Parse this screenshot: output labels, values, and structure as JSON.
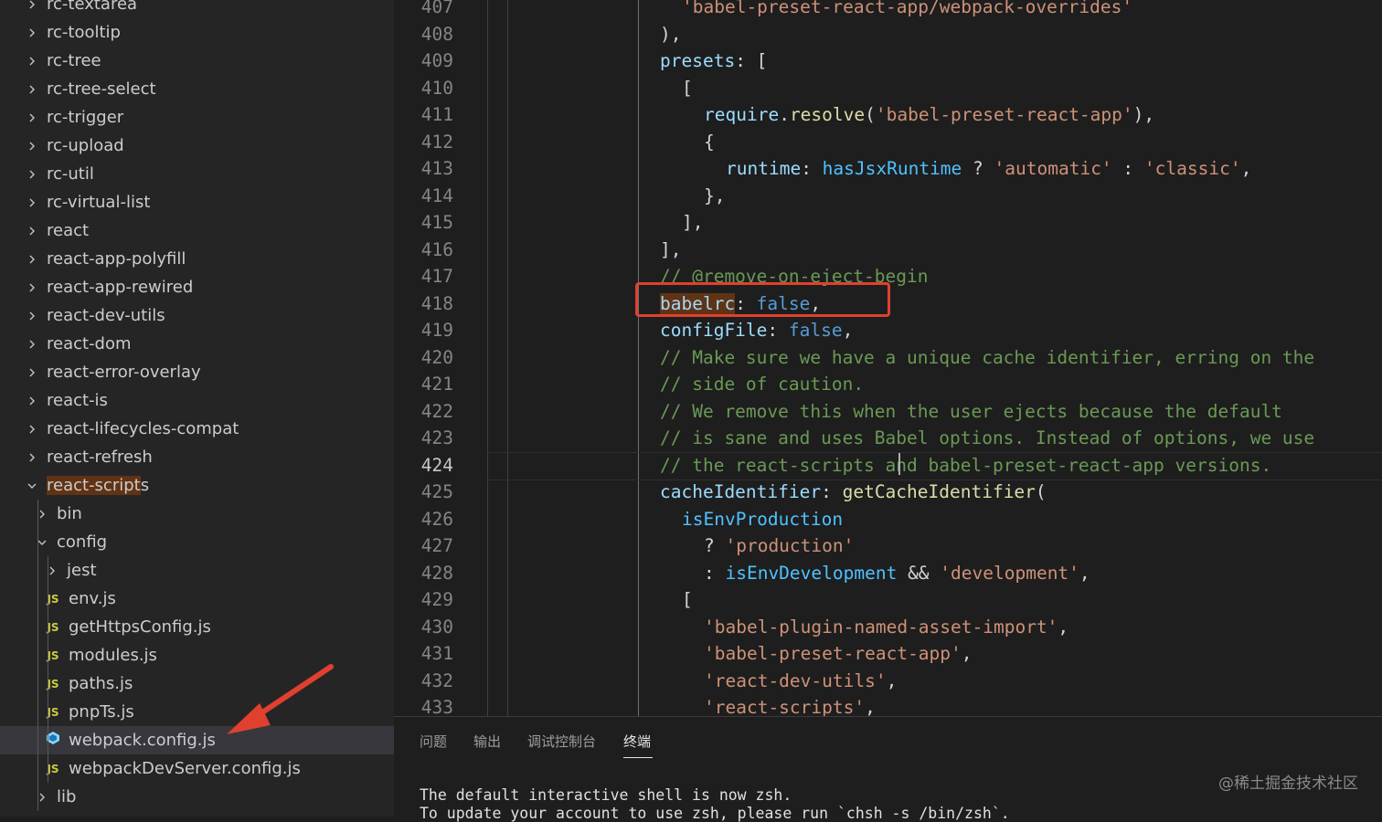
{
  "explorer": {
    "items": [
      {
        "label": "rc-textarea",
        "type": "folder",
        "state": "collapsed",
        "depth": 0
      },
      {
        "label": "rc-tooltip",
        "type": "folder",
        "state": "collapsed",
        "depth": 0
      },
      {
        "label": "rc-tree",
        "type": "folder",
        "state": "collapsed",
        "depth": 0
      },
      {
        "label": "rc-tree-select",
        "type": "folder",
        "state": "collapsed",
        "depth": 0
      },
      {
        "label": "rc-trigger",
        "type": "folder",
        "state": "collapsed",
        "depth": 0
      },
      {
        "label": "rc-upload",
        "type": "folder",
        "state": "collapsed",
        "depth": 0
      },
      {
        "label": "rc-util",
        "type": "folder",
        "state": "collapsed",
        "depth": 0
      },
      {
        "label": "rc-virtual-list",
        "type": "folder",
        "state": "collapsed",
        "depth": 0
      },
      {
        "label": "react",
        "type": "folder",
        "state": "collapsed",
        "depth": 0
      },
      {
        "label": "react-app-polyfill",
        "type": "folder",
        "state": "collapsed",
        "depth": 0
      },
      {
        "label": "react-app-rewired",
        "type": "folder",
        "state": "collapsed",
        "depth": 0
      },
      {
        "label": "react-dev-utils",
        "type": "folder",
        "state": "collapsed",
        "depth": 0
      },
      {
        "label": "react-dom",
        "type": "folder",
        "state": "collapsed",
        "depth": 0
      },
      {
        "label": "react-error-overlay",
        "type": "folder",
        "state": "collapsed",
        "depth": 0
      },
      {
        "label": "react-is",
        "type": "folder",
        "state": "collapsed",
        "depth": 0
      },
      {
        "label": "react-lifecycles-compat",
        "type": "folder",
        "state": "collapsed",
        "depth": 0
      },
      {
        "label": "react-refresh",
        "type": "folder",
        "state": "collapsed",
        "depth": 0
      },
      {
        "label": "react-scripts",
        "type": "folder",
        "state": "expanded",
        "depth": 0,
        "highlight_prefix": "react-script",
        "highlight_rest": "s"
      },
      {
        "label": "bin",
        "type": "folder",
        "state": "collapsed",
        "depth": 1
      },
      {
        "label": "config",
        "type": "folder",
        "state": "expanded",
        "depth": 1
      },
      {
        "label": "jest",
        "type": "folder",
        "state": "collapsed",
        "depth": 2
      },
      {
        "label": "env.js",
        "type": "js",
        "depth": 2
      },
      {
        "label": "getHttpsConfig.js",
        "type": "js",
        "depth": 2
      },
      {
        "label": "modules.js",
        "type": "js",
        "depth": 2
      },
      {
        "label": "paths.js",
        "type": "js",
        "depth": 2
      },
      {
        "label": "pnpTs.js",
        "type": "js",
        "depth": 2
      },
      {
        "label": "webpack.config.js",
        "type": "webpack",
        "depth": 2,
        "selected": true
      },
      {
        "label": "webpackDevServer.config.js",
        "type": "js",
        "depth": 2
      },
      {
        "label": "lib",
        "type": "folder",
        "state": "collapsed",
        "depth": 1
      }
    ],
    "js_badge": "JS",
    "webpack_icon": "webpack-cube-icon"
  },
  "editor": {
    "active_line": 424,
    "lines": [
      {
        "n": "407",
        "indent": 1,
        "tokens": [
          [
            "str",
            "'babel-preset-react-app/webpack-overrides'"
          ]
        ]
      },
      {
        "n": "408",
        "indent": 0,
        "tokens": [
          [
            "punc",
            "),"
          ]
        ]
      },
      {
        "n": "409",
        "indent": 0,
        "tokens": [
          [
            "prop",
            "presets"
          ],
          [
            "punc",
            ": ["
          ]
        ]
      },
      {
        "n": "410",
        "indent": 1,
        "tokens": [
          [
            "punc",
            "["
          ]
        ]
      },
      {
        "n": "411",
        "indent": 2,
        "tokens": [
          [
            "prop",
            "require"
          ],
          [
            "punc",
            "."
          ],
          [
            "fn",
            "resolve"
          ],
          [
            "punc",
            "("
          ],
          [
            "str",
            "'babel-preset-react-app'"
          ],
          [
            "punc",
            "),"
          ]
        ]
      },
      {
        "n": "412",
        "indent": 2,
        "tokens": [
          [
            "punc",
            "{"
          ]
        ]
      },
      {
        "n": "413",
        "indent": 3,
        "tokens": [
          [
            "prop",
            "runtime"
          ],
          [
            "punc",
            ": "
          ],
          [
            "var",
            "hasJsxRuntime"
          ],
          [
            "punc",
            " ? "
          ],
          [
            "str",
            "'automatic'"
          ],
          [
            "punc",
            " : "
          ],
          [
            "str",
            "'classic'"
          ],
          [
            "punc",
            ","
          ]
        ]
      },
      {
        "n": "414",
        "indent": 2,
        "tokens": [
          [
            "punc",
            "},"
          ]
        ]
      },
      {
        "n": "415",
        "indent": 1,
        "tokens": [
          [
            "punc",
            "],"
          ]
        ]
      },
      {
        "n": "416",
        "indent": 0,
        "tokens": [
          [
            "punc",
            "],"
          ]
        ]
      },
      {
        "n": "417",
        "indent": 0,
        "tokens": [
          [
            "cmt",
            "// @remove-on-eject-begin"
          ]
        ]
      },
      {
        "n": "418",
        "indent": 0,
        "tokens": [
          [
            "prophl",
            "babelrc"
          ],
          [
            "punc",
            ": "
          ],
          [
            "kw",
            "false"
          ],
          [
            "punc",
            ","
          ]
        ]
      },
      {
        "n": "419",
        "indent": 0,
        "tokens": [
          [
            "prop",
            "configFile"
          ],
          [
            "punc",
            ": "
          ],
          [
            "kw",
            "false"
          ],
          [
            "punc",
            ","
          ]
        ]
      },
      {
        "n": "420",
        "indent": 0,
        "tokens": [
          [
            "cmt",
            "// Make sure we have a unique cache identifier, erring on the"
          ]
        ]
      },
      {
        "n": "421",
        "indent": 0,
        "tokens": [
          [
            "cmt",
            "// side of caution."
          ]
        ]
      },
      {
        "n": "422",
        "indent": 0,
        "tokens": [
          [
            "cmt",
            "// We remove this when the user ejects because the default"
          ]
        ]
      },
      {
        "n": "423",
        "indent": 0,
        "tokens": [
          [
            "cmt",
            "// is sane and uses Babel options. Instead of options, we use"
          ]
        ]
      },
      {
        "n": "424",
        "indent": 0,
        "tokens": [
          [
            "cmt",
            "// the react-scripts and babel-preset-react-app versions."
          ]
        ]
      },
      {
        "n": "425",
        "indent": 0,
        "tokens": [
          [
            "prop",
            "cacheIdentifier"
          ],
          [
            "punc",
            ": "
          ],
          [
            "fn",
            "getCacheIdentifier"
          ],
          [
            "punc",
            "("
          ]
        ]
      },
      {
        "n": "426",
        "indent": 1,
        "tokens": [
          [
            "var",
            "isEnvProduction"
          ]
        ]
      },
      {
        "n": "427",
        "indent": 2,
        "tokens": [
          [
            "punc",
            "? "
          ],
          [
            "str",
            "'production'"
          ]
        ]
      },
      {
        "n": "428",
        "indent": 2,
        "tokens": [
          [
            "punc",
            ": "
          ],
          [
            "var",
            "isEnvDevelopment"
          ],
          [
            "punc",
            " && "
          ],
          [
            "str",
            "'development'"
          ],
          [
            "punc",
            ","
          ]
        ]
      },
      {
        "n": "429",
        "indent": 1,
        "tokens": [
          [
            "punc",
            "["
          ]
        ]
      },
      {
        "n": "430",
        "indent": 2,
        "tokens": [
          [
            "str",
            "'babel-plugin-named-asset-import'"
          ],
          [
            "punc",
            ","
          ]
        ]
      },
      {
        "n": "431",
        "indent": 2,
        "tokens": [
          [
            "str",
            "'babel-preset-react-app'"
          ],
          [
            "punc",
            ","
          ]
        ]
      },
      {
        "n": "432",
        "indent": 2,
        "tokens": [
          [
            "str",
            "'react-dev-utils'"
          ],
          [
            "punc",
            ","
          ]
        ]
      },
      {
        "n": "433",
        "indent": 2,
        "tokens": [
          [
            "str",
            "'react-scripts'"
          ],
          [
            "punc",
            ","
          ]
        ]
      }
    ]
  },
  "panel": {
    "tabs": [
      {
        "label": "问题",
        "active": false
      },
      {
        "label": "输出",
        "active": false
      },
      {
        "label": "调试控制台",
        "active": false
      },
      {
        "label": "终端",
        "active": true
      }
    ],
    "terminal_lines": [
      "The default interactive shell is now zsh.",
      "To update your account to use zsh, please run `chsh -s /bin/zsh`."
    ]
  },
  "watermark": "@稀土掘金技术社区",
  "colors": {
    "annotation": "#e0402e",
    "selection_highlight": "#613315",
    "sidebar_bg": "#252526",
    "editor_bg": "#1e1e1e"
  }
}
